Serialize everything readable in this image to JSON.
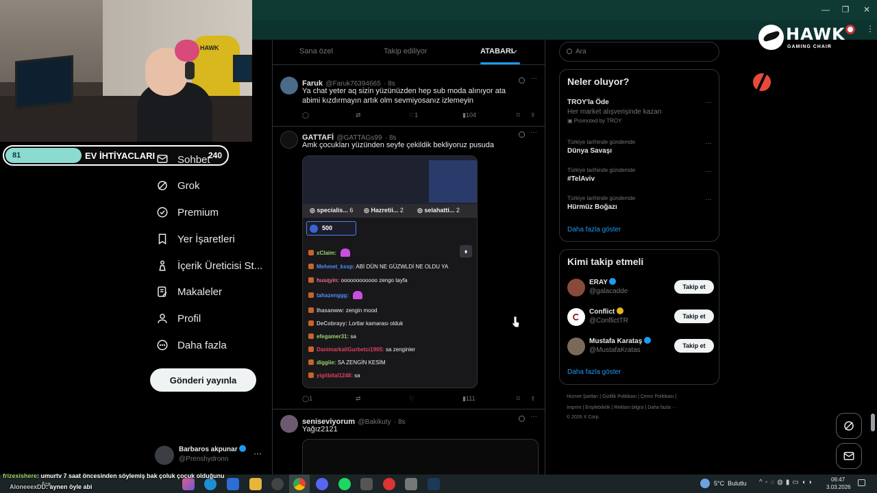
{
  "window": {
    "minimize": "—",
    "restore": "❐",
    "close": "✕"
  },
  "brand": {
    "name": "HAWK",
    "tagline": "GAMING CHAIR"
  },
  "webcam": {
    "chair_text": "HAWK"
  },
  "goal_bar": {
    "left": "81",
    "title": "EV İHTİYACLARI",
    "right": "240",
    "progress": 0.34
  },
  "nav": {
    "items": [
      {
        "label": "Sohbet",
        "icon": "mail-icon"
      },
      {
        "label": "Grok",
        "icon": "grok-icon"
      },
      {
        "label": "Premium",
        "icon": "premium-icon"
      },
      {
        "label": "Yer İşaretleri",
        "icon": "bookmark-icon"
      },
      {
        "label": "İçerik Üreticisi St...",
        "icon": "creator-studio-icon"
      },
      {
        "label": "Makaleler",
        "icon": "article-icon"
      },
      {
        "label": "Profil",
        "icon": "profile-icon"
      },
      {
        "label": "Daha fazla",
        "icon": "more-circle-icon"
      }
    ],
    "post_button": "Gönderi yayınla"
  },
  "account": {
    "name": "Barbaros akpunar",
    "handle": "@Prenshydronn",
    "more": "···"
  },
  "feed": {
    "tabs": [
      {
        "label": "Sana özel"
      },
      {
        "label": "Takip ediliyor"
      },
      {
        "label": "ATABARI"
      }
    ],
    "posts": [
      {
        "name": "Faruk",
        "handle": "@Faruk76394665",
        "time": "· 8s",
        "text": "Ya chat yeter aq sizin yüzünüzden hep sub moda alınıyor ata abimi kızdırmayın artık olm sevmiyosanız izlemeyin",
        "replies": "",
        "reposts": "",
        "likes": "1",
        "views": "104"
      },
      {
        "name": "GATTAFİ",
        "handle": "@GATTAGs99",
        "time": "· 8s",
        "text": "Amk çocukları yüzünden seyfe çekildik bekliyoruz pusuda",
        "replies": "1",
        "reposts": "",
        "likes": "",
        "views": "111"
      },
      {
        "name": "seniseviyorum",
        "handle": "@Bakikuty",
        "time": "· 8s",
        "text": "Yağız2121"
      }
    ],
    "embedded": {
      "top_users": [
        {
          "name": "specialis...",
          "count": "6"
        },
        {
          "name": "Hazretii...",
          "count": "2"
        },
        {
          "name": "selahatti...",
          "count": "2"
        }
      ],
      "points": "500",
      "chat": [
        {
          "user": "xClaim:",
          "msg": "",
          "color": "#9bd36c"
        },
        {
          "user": "Mehmet_kssp:",
          "msg": "ABİ DÜN NE GÜZWLDİ NE OLDU YA",
          "color": "#4f8df5"
        },
        {
          "user": "husqyin:",
          "msg": "oooooooooooo zengo tayfa",
          "color": "#e4708b"
        },
        {
          "user": "tahazenggg:",
          "msg": "",
          "color": "#4f8df5"
        },
        {
          "user": "lhasanww:",
          "msg": "zengin mood",
          "color": "#c0c0c0"
        },
        {
          "user": "DeCobrayy:",
          "msg": "Lortlar kamarası olduk",
          "color": "#c0c0c0"
        },
        {
          "user": "efegamer31:",
          "msg": "sa",
          "color": "#9bd36c"
        },
        {
          "user": "DanimarkaliGurbetci1905:",
          "msg": "sa zenginler",
          "color": "#e0405a"
        },
        {
          "user": "diggiie:",
          "msg": "SA ZENGİN KESİM",
          "color": "#9bd36c"
        },
        {
          "user": "yigitbilal1248:",
          "msg": "sa",
          "color": "#e0405a"
        }
      ]
    }
  },
  "sidebar": {
    "search_placeholder": "Ara",
    "trends_title": "Neler oluyor?",
    "promo": {
      "title": "TROY'la Öde",
      "subtitle": "Her market alışverişinde kazan",
      "promoted": "Promoted by TROY"
    },
    "trends": [
      {
        "context": "Türkiye tarihinde gündemde",
        "name": "Dünya Savaşı"
      },
      {
        "context": "Türkiye tarihinde gündemde",
        "name": "#TelAviv"
      },
      {
        "context": "Türkiye tarihinde gündemde",
        "name": "Hürmüz Boğazı"
      }
    ],
    "show_more": "Daha fazla göster",
    "who_title": "Kimi takip etmeli",
    "who": [
      {
        "name": "ERAY",
        "handle": "@galacadde",
        "button": "Takip et"
      },
      {
        "name": "Conflict",
        "handle": "@ConflictTR",
        "button": "Takip et"
      },
      {
        "name": "Mustafa Karataş",
        "handle": "@MustafaKratas",
        "button": "Takip et"
      }
    ],
    "who_more": "Daha fazla göster",
    "footer_line1": "Hizmet Şartları  |  Gizlilik Politikası  |  Çerez Politikası  |",
    "footer_line2": "Imprint  |  Erişilebilirlik  |  Reklam bilgisi  |  Daha fazla ···",
    "footer_line3": "© 2026 X Corp."
  },
  "stream_chat": [
    {
      "user": "frizexishere",
      "msg": ": umurtv 7 saat öncesinden söylemiş bak çoluk çocuk olduğunu"
    },
    {
      "user": "AloneeexDD",
      "msg": ": aynen öyle abi"
    }
  ],
  "taskbar": {
    "search": "Ara",
    "weather": "5°C  Bulutlu",
    "time": "06:47",
    "date": "3.03.2026"
  },
  "colors": {
    "accent": "#1d9bf0",
    "teal": "#8cdbd3",
    "topbar": "#0f3a33"
  }
}
